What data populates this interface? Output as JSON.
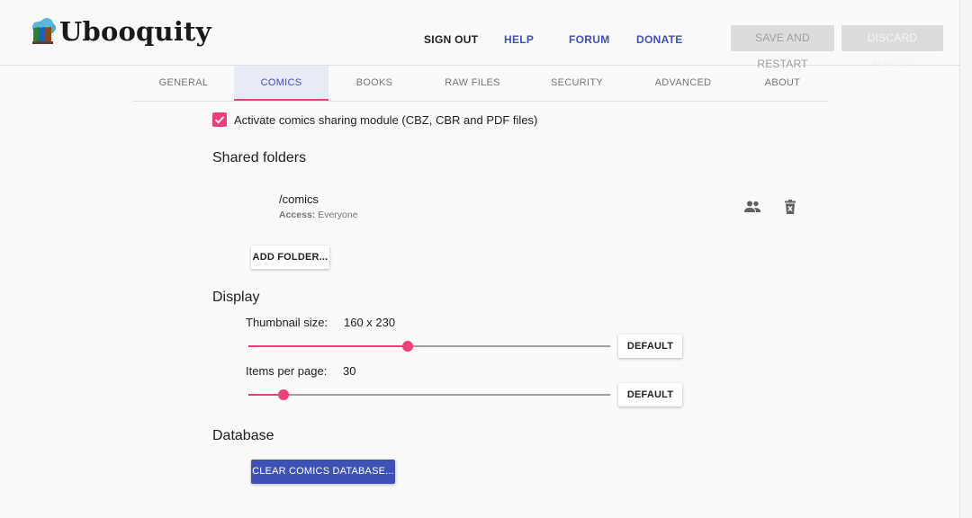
{
  "header": {
    "app_name": "Ubooquity",
    "links": {
      "sign_out": "SIGN OUT",
      "help": "HELP",
      "forum": "FORUM",
      "donate": "DONATE"
    },
    "buttons": {
      "save_restart": "SAVE AND RESTART",
      "discard": "DISCARD CHANGES"
    }
  },
  "tabs": [
    "GENERAL",
    "COMICS",
    "BOOKS",
    "RAW FILES",
    "SECURITY",
    "ADVANCED",
    "ABOUT"
  ],
  "active_tab": "COMICS",
  "comics": {
    "activate_label": "Activate comics sharing module (CBZ, CBR and PDF files)",
    "activate_checked": true,
    "shared_folders_title": "Shared folders",
    "folders": [
      {
        "path": "/comics",
        "access_label": "Access:",
        "access_value": "Everyone"
      }
    ],
    "add_folder_label": "ADD FOLDER...",
    "display_title": "Display",
    "thumbnail_label": "Thumbnail size:",
    "thumbnail_value": "160 x 230",
    "thumbnail_slider_fraction": 0.44,
    "items_label": "Items per page:",
    "items_value": "30",
    "items_slider_fraction": 0.098,
    "default_label": "DEFAULT",
    "database_title": "Database",
    "clear_db_label": "CLEAR COMICS DATABASE..."
  },
  "icons": {
    "logo": "book-cloud-logo-icon",
    "users": "people-icon",
    "delete": "delete-icon"
  },
  "colors": {
    "accent": "#ec407a",
    "primary": "#3f51b5",
    "active_tab_bg": "#e8eaf6",
    "disabled_bg": "#dcdcdc"
  }
}
